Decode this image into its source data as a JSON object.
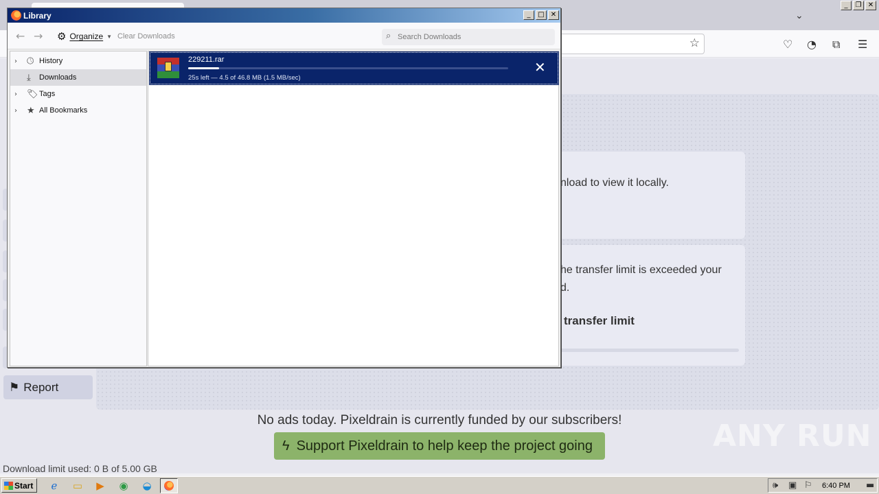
{
  "library": {
    "title": "Library",
    "toolbar": {
      "back_icon": "back-arrow-icon",
      "forward_icon": "forward-arrow-icon",
      "organize_label": "Organize",
      "clear_downloads_label": "Clear Downloads",
      "search_placeholder": "Search Downloads"
    },
    "sidebar": {
      "items": [
        {
          "label": "History",
          "icon": "clock-icon",
          "expandable": true,
          "selected": false
        },
        {
          "label": "Downloads",
          "icon": "download-icon",
          "expandable": false,
          "selected": true
        },
        {
          "label": "Tags",
          "icon": "tag-icon",
          "expandable": true,
          "selected": false
        },
        {
          "label": "All Bookmarks",
          "icon": "star-icon",
          "expandable": true,
          "selected": false
        }
      ]
    },
    "downloads": [
      {
        "filename": "229211.rar",
        "status": "25s left — 4.5 of 46.8 MB (1.5 MB/sec)",
        "progress": 0.096
      }
    ]
  },
  "browser_page": {
    "card1_text": "nload to view it locally.",
    "card2_line1": "he transfer limit is exceeded your",
    "card2_line2": "d.",
    "card2_bold": "transfer limit",
    "report_label": "Report",
    "noads_text": "No ads today. Pixeldrain is currently funded by our subscribers!",
    "support_label": "Support Pixeldrain to help keep the project going",
    "download_limit": "Download limit used: 0 B of 5.00 GB",
    "watermark": "ANY RUN"
  },
  "taskbar": {
    "start_label": "Start",
    "clock": "6:40 PM"
  },
  "colors": {
    "selection_blue": "#0a246a",
    "support_green": "#8cb36a"
  }
}
